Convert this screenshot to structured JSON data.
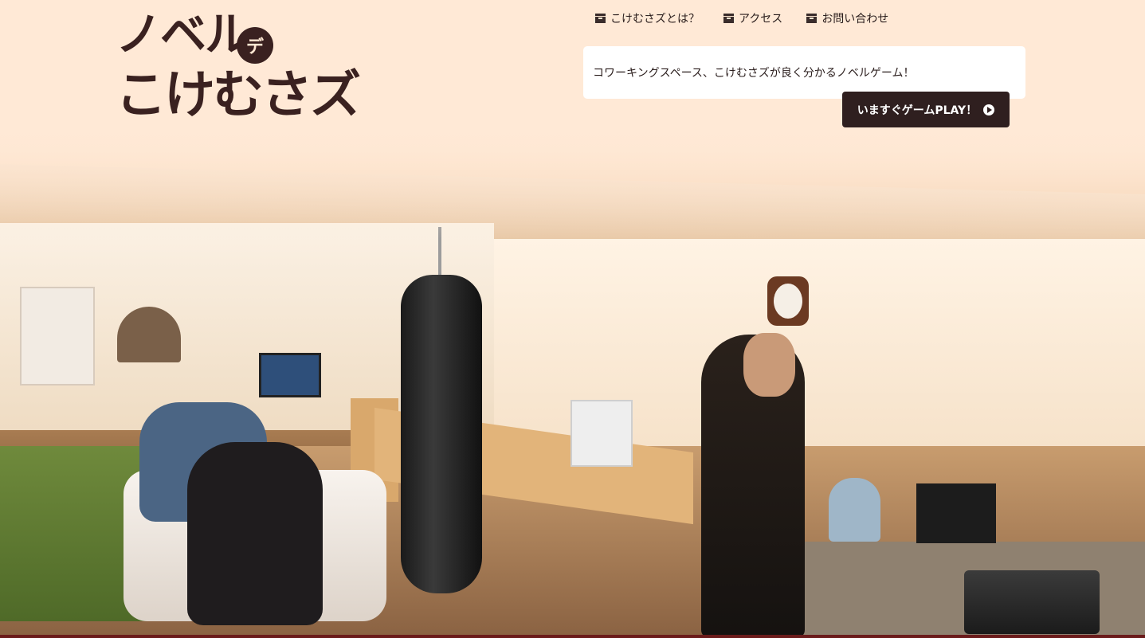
{
  "logo": {
    "line1": "ノベル",
    "badge": "デ",
    "line2": "こけむさズ"
  },
  "nav": {
    "items": [
      {
        "label": "こけむさズとは？",
        "icon": "box-icon"
      },
      {
        "label": "アクセス",
        "icon": "box-icon"
      },
      {
        "label": "お問い合わせ",
        "icon": "box-icon"
      }
    ]
  },
  "description": {
    "text": "コワーキングスペース、こけむさズが良く分かるノベルゲーム！"
  },
  "cta": {
    "label": "いますぐゲームPLAY！",
    "icon": "play-circle-icon"
  },
  "hero": {
    "alt_subject": "coworking-space-photo"
  },
  "colors": {
    "background": "#fde7d2",
    "brand_dark": "#3a2120",
    "button": "#2f1f1f"
  }
}
